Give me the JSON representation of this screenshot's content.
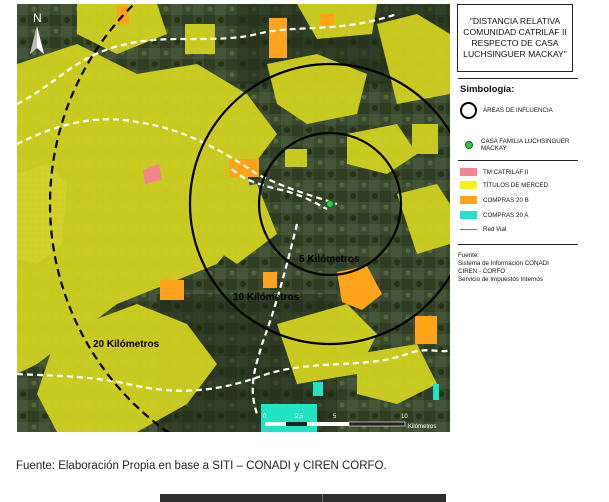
{
  "map": {
    "north_label": "N",
    "ring_labels": {
      "inner": "5 Kilómetros",
      "middle": "10 Kilómetros",
      "outer": "20 Kilómetros"
    },
    "scale": {
      "ticks": [
        "0",
        "2,5",
        "5",
        "10"
      ],
      "unit": "Kilómetros"
    }
  },
  "legend": {
    "title": "\"DISTANCIA RELATIVA COMUNIDAD CATRILAF II RESPECTO DE CASA LUCHSINGUER MACKAY\"",
    "symbology_heading": "Simbología:",
    "items": {
      "influence_areas": "ÁREAS DE INFLUENCIA",
      "house": "CASA FAMILIA LUCHSINGUER MACKAY",
      "tm_catrilaf": "TM CATRILAF II",
      "titulos": "TÍTULOS DE MERCED",
      "compras_20b": "COMPRAS 20 B",
      "compras_20a": "COMPRAS 20 A",
      "red_vial": "Red Vial"
    },
    "colors": {
      "tm_catrilaf": "#f4858d",
      "titulos": "#f2f21e",
      "compras_20b": "#ffa31a",
      "compras_20a": "#22e3c4",
      "red_vial": "#d35b2a",
      "house": "#2ecc40"
    },
    "source_lines": [
      "Fuente:",
      "Sistema de Información CONADI",
      "CIREN - CORFO",
      "Servicio de Impuestos Internos"
    ]
  },
  "caption": "Fuente: Elaboración Propia en base a SITI – CONADI y CIREN CORFO."
}
